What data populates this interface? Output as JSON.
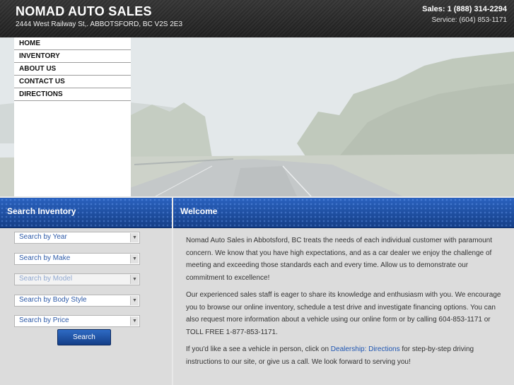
{
  "header": {
    "brand": "NOMAD AUTO SALES",
    "address": "2444 West Railway St,. ABBOTSFORD, BC V2S 2E3",
    "sales_phone": "Sales: 1 (888) 314-2294",
    "service_phone": "Service: (604) 853-1171"
  },
  "nav": {
    "items": [
      {
        "label": "HOME"
      },
      {
        "label": "INVENTORY"
      },
      {
        "label": "ABOUT US"
      },
      {
        "label": "CONTACT US"
      },
      {
        "label": "DIRECTIONS"
      }
    ]
  },
  "search": {
    "title": "Search Inventory",
    "selects": [
      {
        "label": "Search by Year",
        "disabled": false
      },
      {
        "label": "Search by Make",
        "disabled": false
      },
      {
        "label": "Search by Model",
        "disabled": true
      },
      {
        "label": "Search by Body Style",
        "disabled": false
      },
      {
        "label": "Search by Price",
        "disabled": false
      }
    ],
    "button_label": "Search"
  },
  "welcome": {
    "title": "Welcome",
    "p1": "Nomad Auto Sales in Abbotsford, BC treats the needs of each individual customer with paramount concern. We know that you have high expectations, and as a car dealer we enjoy the challenge of meeting and exceeding those standards each and every time. Allow us to demonstrate our commitment to excellence!",
    "p2": "Our experienced sales staff is eager to share its knowledge and enthusiasm with you. We encourage you to browse our online inventory, schedule a test drive and investigate financing options. You can also request more information about a vehicle using our online form or by calling 604-853-1171 or TOLL FREE 1-877-853-1171.",
    "p3_before": "If you'd like a see a vehicle in person, click on ",
    "p3_link": "Dealership: Directions",
    "p3_after": " for step-by-step driving instructions to our site, or give us a call. We look forward to serving you!"
  },
  "colors": {
    "header_bg": "#2a2a2a",
    "panel_blue": "#1d4fa3",
    "link": "#1f56b2"
  }
}
